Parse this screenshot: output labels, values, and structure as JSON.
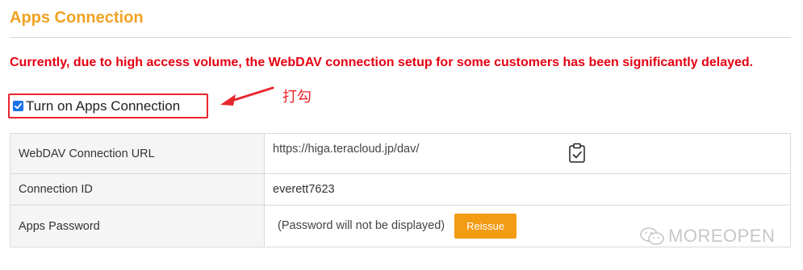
{
  "header": {
    "title": "Apps Connection"
  },
  "notice": {
    "text": "Currently, due to high access volume, the WebDAV connection setup for some customers has been significantly delayed."
  },
  "apps_connection_toggle": {
    "label": "Turn on Apps Connection",
    "checked": true
  },
  "annotation": {
    "text": "打勾",
    "color": "#e8262c"
  },
  "settings_table": {
    "rows": [
      {
        "label": "WebDAV Connection URL",
        "value": "https://higa.teracloud.jp/dav/",
        "icon": "clipboard-check-icon"
      },
      {
        "label": "Connection ID",
        "value": "everett7623"
      },
      {
        "label": "Apps Password",
        "value": "(Password will not be displayed)",
        "button_label": "Reissue"
      }
    ]
  },
  "watermark": {
    "text": "MOREOPEN",
    "icon": "wechat-icon"
  },
  "colors": {
    "title": "#f0a223",
    "notice": "#e60012",
    "button": "#f39b12",
    "checkbox": "#1a73e8"
  }
}
